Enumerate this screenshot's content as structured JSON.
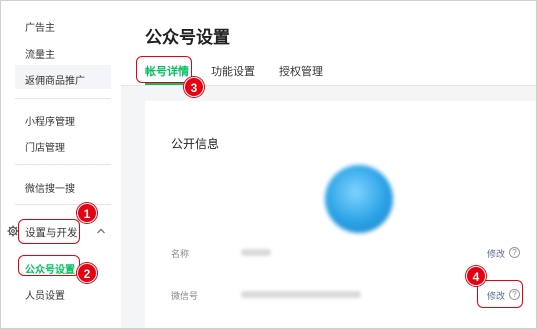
{
  "sidebar": {
    "items": [
      {
        "label": "广告主"
      },
      {
        "label": "流量主"
      },
      {
        "label": "返佣商品推广"
      },
      {
        "label": "小程序管理"
      },
      {
        "label": "门店管理"
      },
      {
        "label": "微信搜一搜"
      },
      {
        "label": "设置与开发"
      },
      {
        "label": "公众号设置"
      },
      {
        "label": "人员设置"
      }
    ]
  },
  "main": {
    "title": "公众号设置",
    "tabs": [
      {
        "label": "帐号详情"
      },
      {
        "label": "功能设置"
      },
      {
        "label": "授权管理"
      }
    ],
    "card": {
      "title": "公开信息",
      "fields": [
        {
          "label": "名称",
          "action": "修改"
        },
        {
          "label": "微信号",
          "action": "修改"
        }
      ],
      "help_glyph": "?"
    }
  },
  "annotations": {
    "steps": [
      "1",
      "2",
      "3",
      "4"
    ],
    "color": "#e60012"
  },
  "colors": {
    "accent": "#07c160",
    "link": "#576b95"
  }
}
